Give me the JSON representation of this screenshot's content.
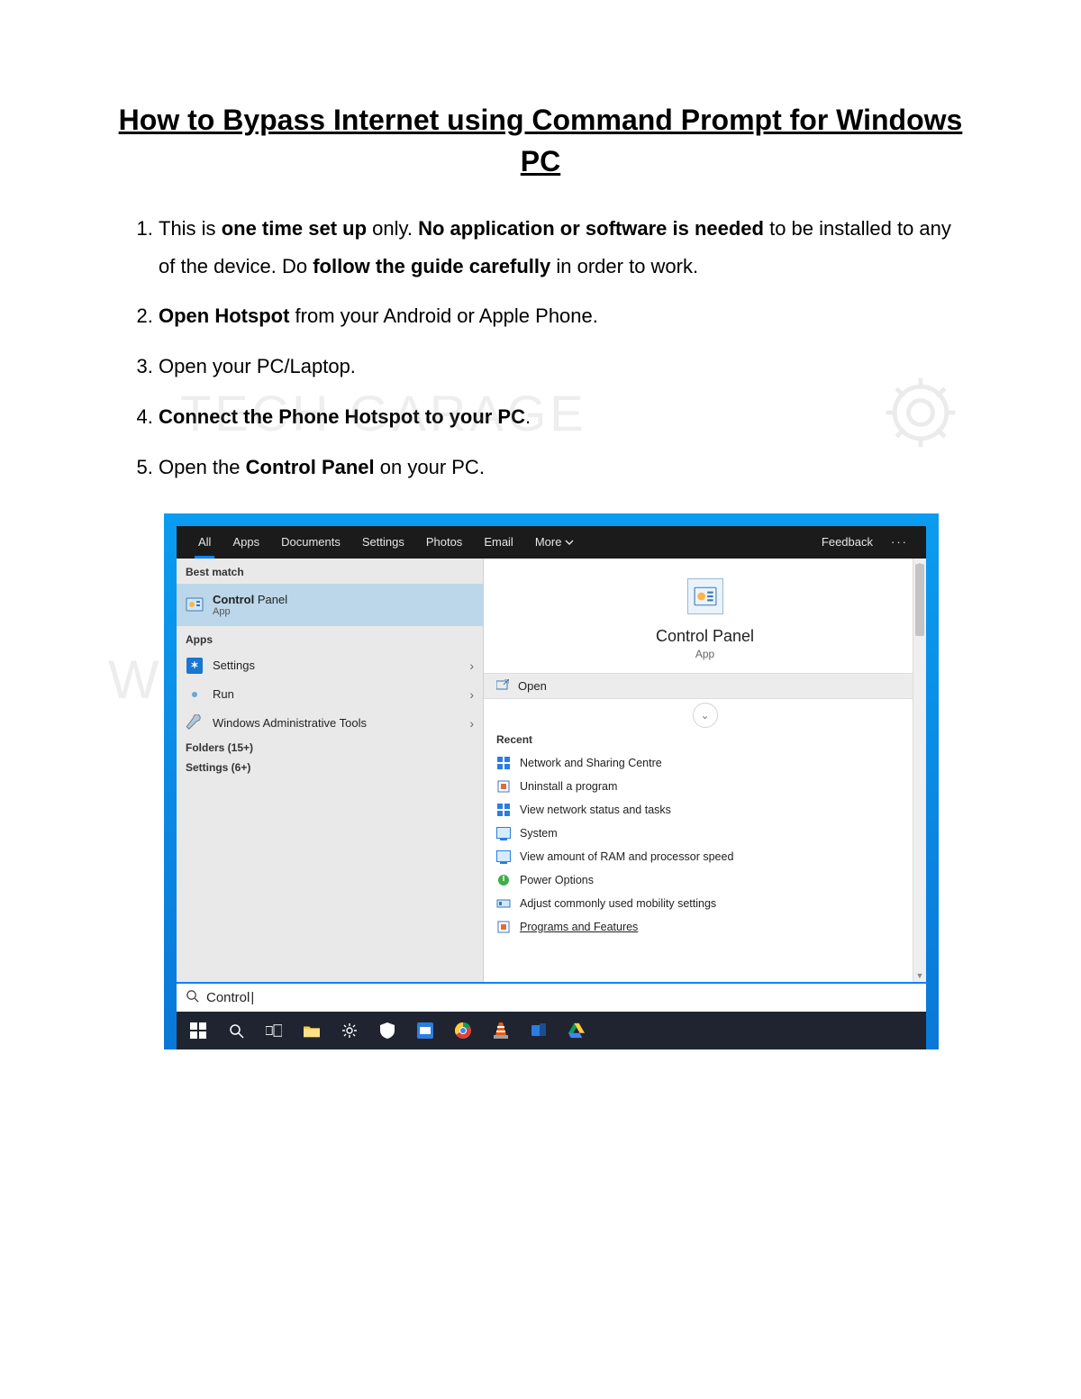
{
  "title": "How to Bypass Internet using Command Prompt for Windows PC",
  "watermark_text": "TECH GARAGE",
  "steps": [
    {
      "pre": "This is ",
      "b1": "one time set up",
      "mid1": " only. ",
      "b2": "No application or software is needed",
      "mid2": " to be installed to any of the device. Do ",
      "b3": "follow the guide carefully",
      "post": " in order to work."
    },
    {
      "b1": "Open Hotspot",
      "post": " from your Android or Apple Phone."
    },
    {
      "pre": "Open your PC/Laptop."
    },
    {
      "b1": "Connect the Phone Hotspot to your PC",
      "post": "."
    },
    {
      "pre": "Open the ",
      "b1": "Control Panel",
      "post": " on your PC."
    }
  ],
  "tabs": [
    "All",
    "Apps",
    "Documents",
    "Settings",
    "Photos",
    "Email"
  ],
  "tabs_more": "More",
  "tabs_feedback": "Feedback",
  "left": {
    "best_match_label": "Best match",
    "best_title": "Control",
    "best_title_rest": " Panel",
    "best_sub": "App",
    "apps_label": "Apps",
    "apps": [
      "Settings",
      "Run",
      "Windows Administrative Tools"
    ],
    "folders": "Folders (15+)",
    "settings": "Settings (6+)"
  },
  "right": {
    "hero_title": "Control Panel",
    "hero_sub": "App",
    "open_label": "Open",
    "recent_label": "Recent",
    "recent": [
      "Network and Sharing Centre",
      "Uninstall a program",
      "View network status and tasks",
      "System",
      "View amount of RAM and processor speed",
      "Power Options",
      "Adjust commonly used mobility settings",
      "Programs and Features"
    ]
  },
  "search_value": "Control",
  "taskbar_icons": [
    "start",
    "search",
    "task-view",
    "file-explorer",
    "settings-gear",
    "security",
    "people",
    "chrome",
    "vlc",
    "your-phone",
    "drive"
  ]
}
